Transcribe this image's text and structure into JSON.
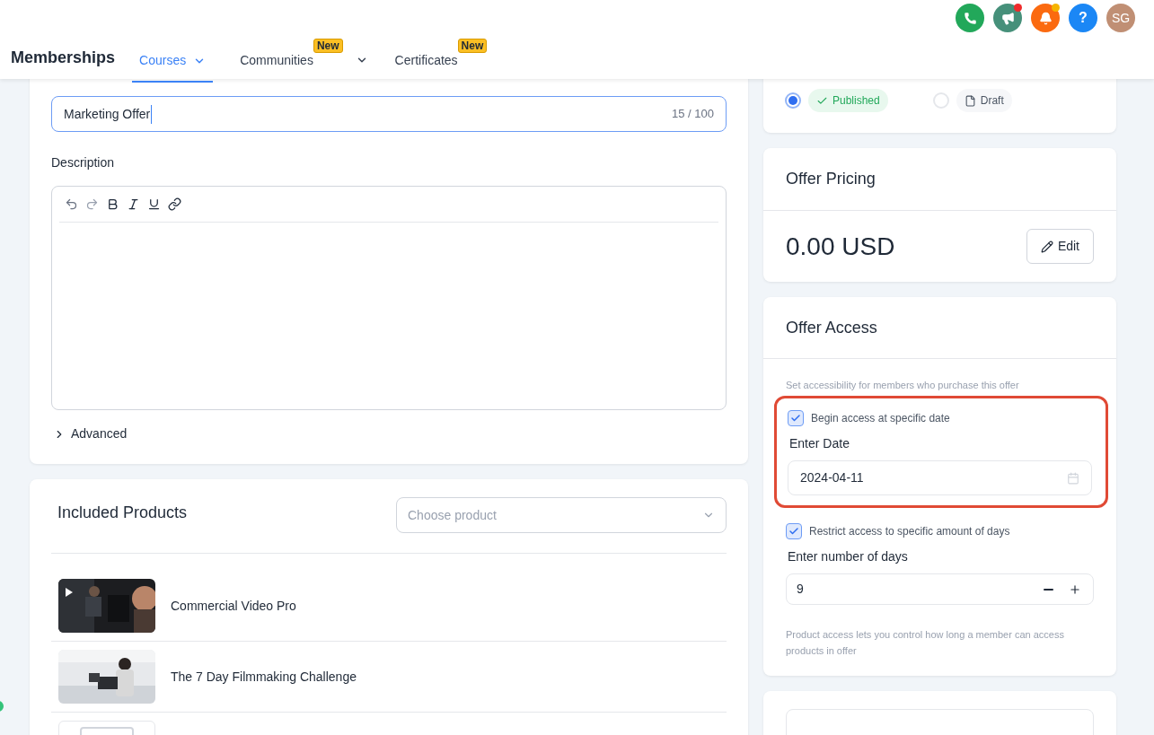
{
  "header": {
    "actions": [
      {
        "kind": "phone"
      },
      {
        "kind": "megaphone",
        "color": "#ef2b2b"
      },
      {
        "kind": "bell",
        "color": "#f5b400"
      },
      {
        "kind": "help",
        "text": "?"
      },
      {
        "kind": "avatar",
        "text": "SG"
      }
    ],
    "title": "Memberships",
    "tabs": [
      {
        "label": "Courses",
        "selected": true,
        "has_menu": true
      },
      {
        "label": "Communities",
        "selected": false,
        "badge": "New",
        "has_menu": true
      },
      {
        "label": "Certificates",
        "selected": false,
        "badge": "New",
        "has_menu": false
      }
    ]
  },
  "offer_form": {
    "title_field": {
      "value": "Marketing Offer",
      "counter": "15 / 100"
    },
    "description": {
      "label": "Description"
    },
    "advanced": {
      "label": "Advanced",
      "expanded": false
    }
  },
  "included_products": {
    "title": "Included Products",
    "select_placeholder": "Choose product",
    "items": [
      {
        "name": "Commercial Video Pro",
        "has_image": true
      },
      {
        "name": "The 7 Day Filmmaking Challenge",
        "has_image": true
      },
      {
        "has_image": false
      }
    ]
  },
  "status": {
    "options": [
      {
        "label": "Published",
        "kind": "published",
        "selected": true
      },
      {
        "label": "Draft",
        "kind": "draft",
        "selected": false
      }
    ]
  },
  "offer_pricing": {
    "title": "Offer Pricing",
    "amount": "0.00 USD",
    "edit_button": "Edit"
  },
  "offer_access": {
    "title": "Offer Access",
    "description": "Set accessibility for members who purchase this offer",
    "options": [
      {
        "label": "Begin access at specific date",
        "checked": true,
        "highlighted": true,
        "kind": "date",
        "field_label": "Enter Date",
        "value": "2024-04-11"
      },
      {
        "label": "Restrict access to specific amount of days",
        "checked": true,
        "highlighted": false,
        "kind": "number",
        "field_label": "Enter number of days",
        "value": "9"
      }
    ],
    "help": "Product access lets you control how long a member can access products in offer"
  }
}
